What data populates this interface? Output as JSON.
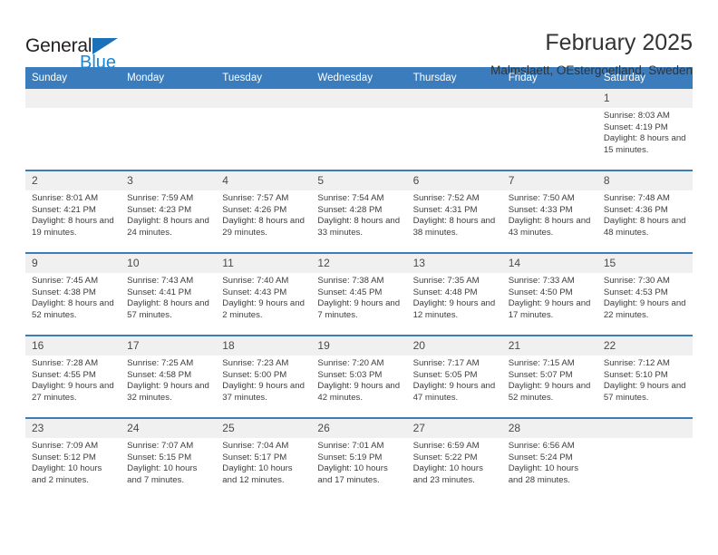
{
  "brand": {
    "name_part1": "General",
    "name_part2": "Blue",
    "triangle_color": "#1b72b8",
    "blue_color": "#1b87d3"
  },
  "header": {
    "title": "February 2025",
    "subtitle": "Malmslaett, OEstergoetland, Sweden"
  },
  "theme": {
    "header_blue": "#3b7cbd",
    "daynum_band": "#f0f0f0",
    "text": "#333333"
  },
  "calendar": {
    "weekday_headers": [
      "Sunday",
      "Monday",
      "Tuesday",
      "Wednesday",
      "Thursday",
      "Friday",
      "Saturday"
    ],
    "weeks": [
      [
        {
          "day": "",
          "empty": true
        },
        {
          "day": "",
          "empty": true
        },
        {
          "day": "",
          "empty": true
        },
        {
          "day": "",
          "empty": true
        },
        {
          "day": "",
          "empty": true
        },
        {
          "day": "",
          "empty": true
        },
        {
          "day": "1",
          "sunrise": "Sunrise: 8:03 AM",
          "sunset": "Sunset: 4:19 PM",
          "daylight": "Daylight: 8 hours and 15 minutes."
        }
      ],
      [
        {
          "day": "2",
          "sunrise": "Sunrise: 8:01 AM",
          "sunset": "Sunset: 4:21 PM",
          "daylight": "Daylight: 8 hours and 19 minutes."
        },
        {
          "day": "3",
          "sunrise": "Sunrise: 7:59 AM",
          "sunset": "Sunset: 4:23 PM",
          "daylight": "Daylight: 8 hours and 24 minutes."
        },
        {
          "day": "4",
          "sunrise": "Sunrise: 7:57 AM",
          "sunset": "Sunset: 4:26 PM",
          "daylight": "Daylight: 8 hours and 29 minutes."
        },
        {
          "day": "5",
          "sunrise": "Sunrise: 7:54 AM",
          "sunset": "Sunset: 4:28 PM",
          "daylight": "Daylight: 8 hours and 33 minutes."
        },
        {
          "day": "6",
          "sunrise": "Sunrise: 7:52 AM",
          "sunset": "Sunset: 4:31 PM",
          "daylight": "Daylight: 8 hours and 38 minutes."
        },
        {
          "day": "7",
          "sunrise": "Sunrise: 7:50 AM",
          "sunset": "Sunset: 4:33 PM",
          "daylight": "Daylight: 8 hours and 43 minutes."
        },
        {
          "day": "8",
          "sunrise": "Sunrise: 7:48 AM",
          "sunset": "Sunset: 4:36 PM",
          "daylight": "Daylight: 8 hours and 48 minutes."
        }
      ],
      [
        {
          "day": "9",
          "sunrise": "Sunrise: 7:45 AM",
          "sunset": "Sunset: 4:38 PM",
          "daylight": "Daylight: 8 hours and 52 minutes."
        },
        {
          "day": "10",
          "sunrise": "Sunrise: 7:43 AM",
          "sunset": "Sunset: 4:41 PM",
          "daylight": "Daylight: 8 hours and 57 minutes."
        },
        {
          "day": "11",
          "sunrise": "Sunrise: 7:40 AM",
          "sunset": "Sunset: 4:43 PM",
          "daylight": "Daylight: 9 hours and 2 minutes."
        },
        {
          "day": "12",
          "sunrise": "Sunrise: 7:38 AM",
          "sunset": "Sunset: 4:45 PM",
          "daylight": "Daylight: 9 hours and 7 minutes."
        },
        {
          "day": "13",
          "sunrise": "Sunrise: 7:35 AM",
          "sunset": "Sunset: 4:48 PM",
          "daylight": "Daylight: 9 hours and 12 minutes."
        },
        {
          "day": "14",
          "sunrise": "Sunrise: 7:33 AM",
          "sunset": "Sunset: 4:50 PM",
          "daylight": "Daylight: 9 hours and 17 minutes."
        },
        {
          "day": "15",
          "sunrise": "Sunrise: 7:30 AM",
          "sunset": "Sunset: 4:53 PM",
          "daylight": "Daylight: 9 hours and 22 minutes."
        }
      ],
      [
        {
          "day": "16",
          "sunrise": "Sunrise: 7:28 AM",
          "sunset": "Sunset: 4:55 PM",
          "daylight": "Daylight: 9 hours and 27 minutes."
        },
        {
          "day": "17",
          "sunrise": "Sunrise: 7:25 AM",
          "sunset": "Sunset: 4:58 PM",
          "daylight": "Daylight: 9 hours and 32 minutes."
        },
        {
          "day": "18",
          "sunrise": "Sunrise: 7:23 AM",
          "sunset": "Sunset: 5:00 PM",
          "daylight": "Daylight: 9 hours and 37 minutes."
        },
        {
          "day": "19",
          "sunrise": "Sunrise: 7:20 AM",
          "sunset": "Sunset: 5:03 PM",
          "daylight": "Daylight: 9 hours and 42 minutes."
        },
        {
          "day": "20",
          "sunrise": "Sunrise: 7:17 AM",
          "sunset": "Sunset: 5:05 PM",
          "daylight": "Daylight: 9 hours and 47 minutes."
        },
        {
          "day": "21",
          "sunrise": "Sunrise: 7:15 AM",
          "sunset": "Sunset: 5:07 PM",
          "daylight": "Daylight: 9 hours and 52 minutes."
        },
        {
          "day": "22",
          "sunrise": "Sunrise: 7:12 AM",
          "sunset": "Sunset: 5:10 PM",
          "daylight": "Daylight: 9 hours and 57 minutes."
        }
      ],
      [
        {
          "day": "23",
          "sunrise": "Sunrise: 7:09 AM",
          "sunset": "Sunset: 5:12 PM",
          "daylight": "Daylight: 10 hours and 2 minutes."
        },
        {
          "day": "24",
          "sunrise": "Sunrise: 7:07 AM",
          "sunset": "Sunset: 5:15 PM",
          "daylight": "Daylight: 10 hours and 7 minutes."
        },
        {
          "day": "25",
          "sunrise": "Sunrise: 7:04 AM",
          "sunset": "Sunset: 5:17 PM",
          "daylight": "Daylight: 10 hours and 12 minutes."
        },
        {
          "day": "26",
          "sunrise": "Sunrise: 7:01 AM",
          "sunset": "Sunset: 5:19 PM",
          "daylight": "Daylight: 10 hours and 17 minutes."
        },
        {
          "day": "27",
          "sunrise": "Sunrise: 6:59 AM",
          "sunset": "Sunset: 5:22 PM",
          "daylight": "Daylight: 10 hours and 23 minutes."
        },
        {
          "day": "28",
          "sunrise": "Sunrise: 6:56 AM",
          "sunset": "Sunset: 5:24 PM",
          "daylight": "Daylight: 10 hours and 28 minutes."
        },
        {
          "day": "",
          "empty": true
        }
      ]
    ]
  }
}
